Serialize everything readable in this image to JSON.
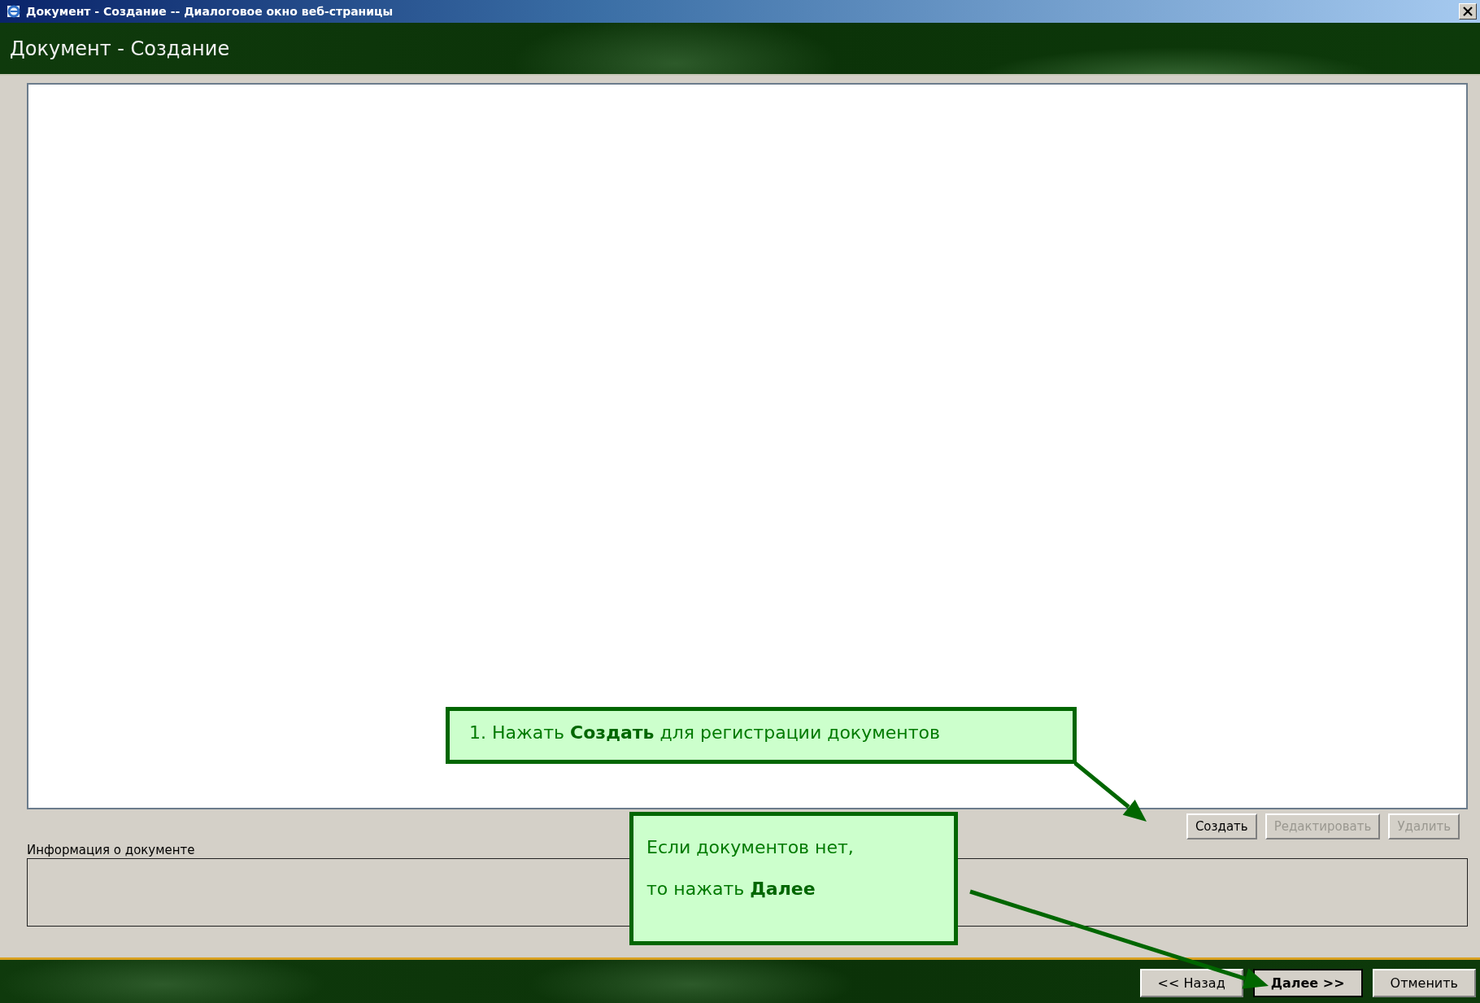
{
  "window": {
    "title": "Документ - Создание -- Диалоговое окно веб-страницы"
  },
  "header": {
    "title": "Документ - Создание"
  },
  "list_buttons": [
    {
      "label": "Создать",
      "disabled": false
    },
    {
      "label": "Редактировать",
      "disabled": true
    },
    {
      "label": "Удалить",
      "disabled": true
    }
  ],
  "info": {
    "label": "Информация о документе"
  },
  "footer_buttons": [
    {
      "label": "<< Назад",
      "default": false
    },
    {
      "label": "Далее >>",
      "default": true
    },
    {
      "label": "Отменить",
      "default": false
    }
  ],
  "callouts": [
    {
      "text": "1. Нажать **Создать** для регистрации документов"
    },
    {
      "text": "Если документов нет,\nто нажать **Далее**"
    }
  ]
}
